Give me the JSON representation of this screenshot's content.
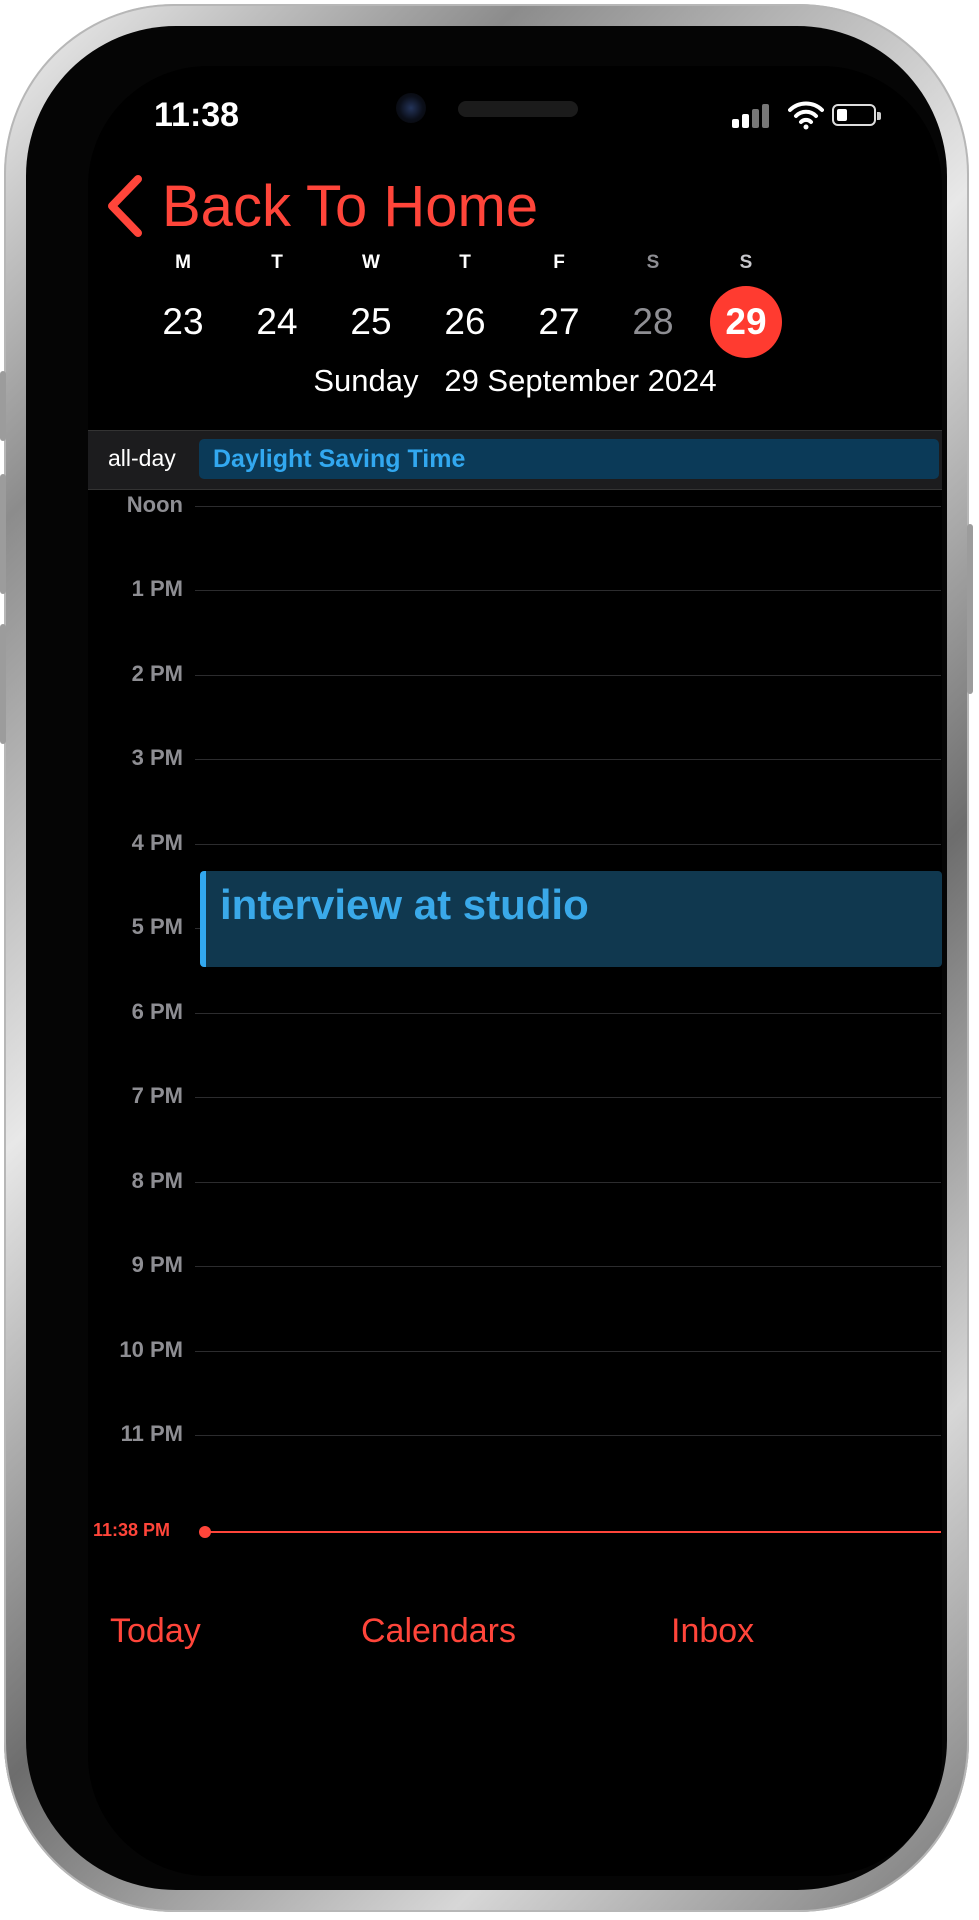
{
  "status_bar": {
    "time": "11:38"
  },
  "nav": {
    "back_label": "Back To Home"
  },
  "week": {
    "days": [
      {
        "weekday": "M",
        "date": "23"
      },
      {
        "weekday": "T",
        "date": "24"
      },
      {
        "weekday": "W",
        "date": "25"
      },
      {
        "weekday": "T",
        "date": "26"
      },
      {
        "weekday": "F",
        "date": "27"
      },
      {
        "weekday": "S",
        "date": "28"
      },
      {
        "weekday": "S",
        "date": "29"
      }
    ],
    "selected_date": "29"
  },
  "date_header": "Sunday   29 September 2024",
  "all_day": {
    "label": "all-day",
    "event": "Daylight Saving Time"
  },
  "timeline": {
    "hours": [
      "Noon",
      "1 PM",
      "2 PM",
      "3 PM",
      "4 PM",
      "5 PM",
      "6 PM",
      "7 PM",
      "8 PM",
      "9 PM",
      "10 PM",
      "11 PM"
    ],
    "current_time": "11:38 PM"
  },
  "event": {
    "title": "interview at studio",
    "start": "4 PM",
    "end": "5 PM"
  },
  "tabs": {
    "today": "Today",
    "calendars": "Calendars",
    "inbox": "Inbox"
  },
  "colors": {
    "accent": "#ff453a",
    "event_text": "#32a8f0",
    "event_background": "#10384f",
    "background": "#000000"
  }
}
